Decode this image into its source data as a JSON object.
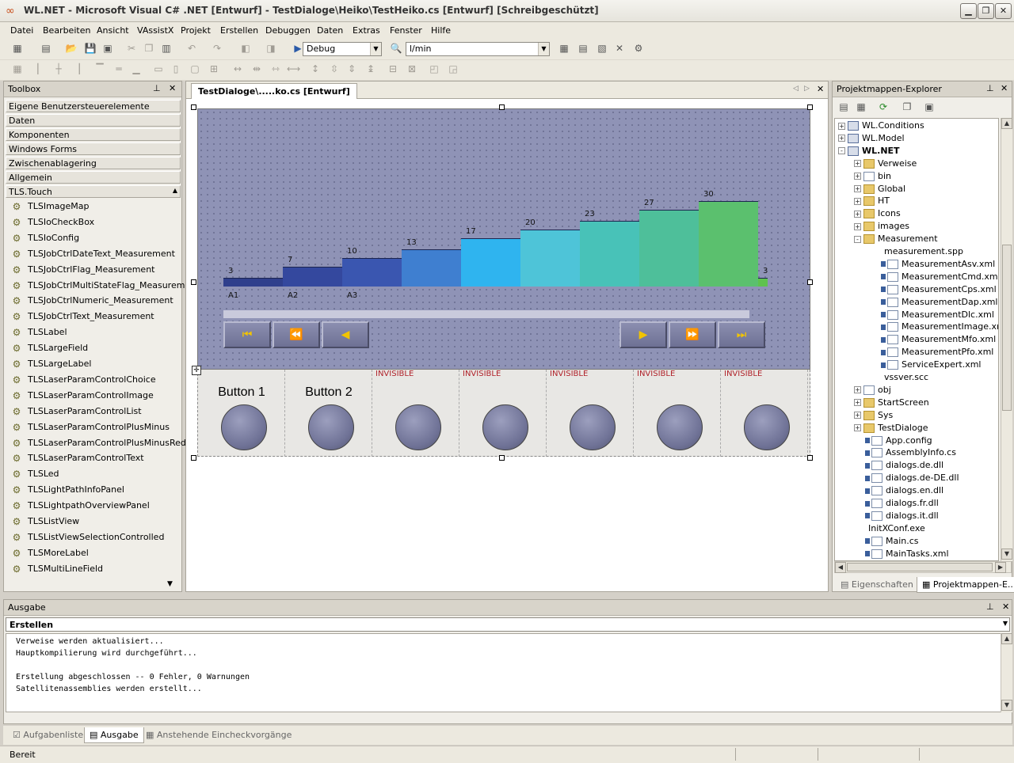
{
  "window": {
    "title": "WL.NET - Microsoft Visual C# .NET [Entwurf] - TestDialoge\\Heiko\\TestHeiko.cs [Entwurf] [Schreibgeschützt]",
    "controls": [
      "minimize-icon",
      "maximize-icon",
      "close-icon"
    ]
  },
  "menu": [
    "Datei",
    "Bearbeiten",
    "Ansicht",
    "VAssistX",
    "Projekt",
    "Erstellen",
    "Debuggen",
    "Daten",
    "Extras",
    "Fenster",
    "Hilfe"
  ],
  "toolbar": {
    "config_value": "Debug",
    "unit_value": "l/min"
  },
  "toolbox": {
    "title": "Toolbox",
    "categories": [
      "Eigene Benutzersteuerelemente",
      "Daten",
      "Komponenten",
      "Windows Forms",
      "Zwischenablagering",
      "Allgemein",
      "TLS.Touch"
    ],
    "items": [
      "TLSImageMap",
      "TLSIoCheckBox",
      "TLSIoConfig",
      "TLSJobCtrlDateText_Measurement",
      "TLSJobCtrlFlag_Measurement",
      "TLSJobCtrlMultiStateFlag_Measurement",
      "TLSJobCtrlNumeric_Measurement",
      "TLSJobCtrlText_Measurement",
      "TLSLabel",
      "TLSLargeField",
      "TLSLargeLabel",
      "TLSLaserParamControlChoice",
      "TLSLaserParamControlImage",
      "TLSLaserParamControlList",
      "TLSLaserParamControlPlusMinus",
      "TLSLaserParamControlPlusMinusRed...",
      "TLSLaserParamControlText",
      "TLSLed",
      "TLSLightPathInfoPanel",
      "TLSLightpathOverviewPanel",
      "TLSListView",
      "TLSListViewSelectionControlled",
      "TLSMoreLabel",
      "TLSMultiLineField"
    ]
  },
  "designer": {
    "tab_label": "TestDialoge\\.....ko.cs [Entwurf]",
    "buttons": [
      {
        "label": "Button 1",
        "state": ""
      },
      {
        "label": "Button 2",
        "state": ""
      },
      {
        "label": "",
        "state": "INVISIBLE"
      },
      {
        "label": "",
        "state": "INVISIBLE"
      },
      {
        "label": "",
        "state": "INVISIBLE"
      },
      {
        "label": "",
        "state": "INVISIBLE"
      },
      {
        "label": "",
        "state": "INVISIBLE"
      }
    ],
    "nav_icons": [
      "first-icon",
      "rewind-icon",
      "prev-icon",
      "next-icon",
      "fast-forward-icon",
      "last-icon"
    ]
  },
  "chart_data": {
    "type": "bar",
    "categories": [
      "A1",
      "A2",
      "A3",
      "",
      "",
      "",
      "",
      "",
      "",
      "",
      ""
    ],
    "values": [
      3,
      7,
      10,
      13,
      17,
      20,
      23,
      27,
      30,
      3
    ],
    "colors": [
      "#2f3f8c",
      "#34489e",
      "#3a56b0",
      "#3f7fd0",
      "#2fb4ef",
      "#4ec4d8",
      "#48c2b8",
      "#4ebf9a",
      "#5bc06e",
      "#5fc24e"
    ],
    "ylim": [
      0,
      50
    ]
  },
  "solution_explorer": {
    "title": "Projektmappen-Explorer",
    "nodes": [
      {
        "label": "WL.Conditions",
        "level": 0,
        "kind": "proj",
        "exp": "+"
      },
      {
        "label": "WL.Model",
        "level": 0,
        "kind": "proj",
        "exp": "+"
      },
      {
        "label": "WL.NET",
        "level": 0,
        "kind": "proj",
        "exp": "-",
        "bold": true
      },
      {
        "label": "Verweise",
        "level": 1,
        "kind": "fold",
        "exp": "+"
      },
      {
        "label": "bin",
        "level": 1,
        "kind": "file",
        "exp": "+"
      },
      {
        "label": "Global",
        "level": 1,
        "kind": "fold",
        "exp": "+"
      },
      {
        "label": "HT",
        "level": 1,
        "kind": "fold",
        "exp": "+"
      },
      {
        "label": "Icons",
        "level": 1,
        "kind": "fold",
        "exp": "+"
      },
      {
        "label": "images",
        "level": 1,
        "kind": "fold",
        "exp": "+"
      },
      {
        "label": "Measurement",
        "level": 1,
        "kind": "fold",
        "exp": "-"
      },
      {
        "label": "measurement.spp",
        "level": 2,
        "kind": "none"
      },
      {
        "label": "MeasurementAsv.xml",
        "level": 2,
        "kind": "file",
        "lock": true
      },
      {
        "label": "MeasurementCmd.xml",
        "level": 2,
        "kind": "file",
        "lock": true
      },
      {
        "label": "MeasurementCps.xml",
        "level": 2,
        "kind": "file",
        "lock": true
      },
      {
        "label": "MeasurementDap.xml",
        "level": 2,
        "kind": "file",
        "lock": true
      },
      {
        "label": "MeasurementDlc.xml",
        "level": 2,
        "kind": "file",
        "lock": true
      },
      {
        "label": "MeasurementImage.xml",
        "level": 2,
        "kind": "file",
        "lock": true
      },
      {
        "label": "MeasurementMfo.xml",
        "level": 2,
        "kind": "file",
        "lock": true
      },
      {
        "label": "MeasurementPfo.xml",
        "level": 2,
        "kind": "file",
        "lock": true
      },
      {
        "label": "ServiceExpert.xml",
        "level": 2,
        "kind": "file",
        "lock": true
      },
      {
        "label": "vssver.scc",
        "level": 2,
        "kind": "none"
      },
      {
        "label": "obj",
        "level": 1,
        "kind": "file",
        "exp": "+"
      },
      {
        "label": "StartScreen",
        "level": 1,
        "kind": "fold",
        "exp": "+"
      },
      {
        "label": "Sys",
        "level": 1,
        "kind": "fold",
        "exp": "+"
      },
      {
        "label": "TestDialoge",
        "level": 1,
        "kind": "fold",
        "exp": "+"
      },
      {
        "label": "App.config",
        "level": 1,
        "kind": "file",
        "lock": true
      },
      {
        "label": "AssemblyInfo.cs",
        "level": 1,
        "kind": "file",
        "lock": true
      },
      {
        "label": "dialogs.de.dll",
        "level": 1,
        "kind": "file",
        "lock": true
      },
      {
        "label": "dialogs.de-DE.dll",
        "level": 1,
        "kind": "file",
        "lock": true
      },
      {
        "label": "dialogs.en.dll",
        "level": 1,
        "kind": "file",
        "lock": true
      },
      {
        "label": "dialogs.fr.dll",
        "level": 1,
        "kind": "file",
        "lock": true
      },
      {
        "label": "dialogs.it.dll",
        "level": 1,
        "kind": "file",
        "lock": true
      },
      {
        "label": "InitXConf.exe",
        "level": 1,
        "kind": "none"
      },
      {
        "label": "Main.cs",
        "level": 1,
        "kind": "file",
        "lock": true
      },
      {
        "label": "MainTasks.xml",
        "level": 1,
        "kind": "file",
        "lock": true
      }
    ],
    "tabs": [
      "Eigenschaften",
      "Projektmappen-E..."
    ]
  },
  "output": {
    "title": "Ausgabe",
    "selector": "Erstellen",
    "lines": [
      "Verweise werden aktualisiert...",
      "Hauptkompilierung wird durchgeführt...",
      "",
      "Erstellung abgeschlossen -- 0 Fehler, 0 Warnungen",
      "Satellitenassemblies werden erstellt..."
    ]
  },
  "bottom_tabs": [
    "Aufgabenliste",
    "Ausgabe",
    "Anstehende Eincheckvorgänge"
  ],
  "status": "Bereit"
}
